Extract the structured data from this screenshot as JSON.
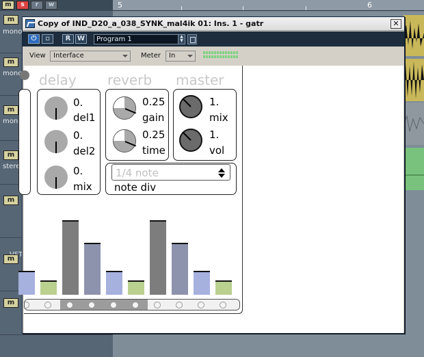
{
  "daw": {
    "ruler_numbers": [
      "5",
      "6"
    ],
    "top_buttons": [
      "m",
      "s",
      "r",
      "w"
    ],
    "tracks": [
      {
        "m": "m",
        "label": "mono"
      },
      {
        "m": "m",
        "label": "mono"
      },
      {
        "m": "m",
        "label": "mono"
      },
      {
        "m": "m",
        "label": "stereo"
      },
      {
        "m": "m",
        "label": ""
      },
      {
        "m": "m",
        "label": ""
      },
      {
        "m": "m",
        "label": ""
      }
    ],
    "vst_label": "VST"
  },
  "window": {
    "title": "Copy of IND_D20_a_038_SYNK_mal4ik 01: Ins. 1 - gatr",
    "close_label": "✕"
  },
  "toolbar": {
    "bypass_label": "⏻",
    "save_label": "▫",
    "read_label": "R",
    "write_label": "W",
    "program": "Program 1"
  },
  "view_bar": {
    "view_label": "View",
    "view_value": "Interface",
    "meter_label": "Meter",
    "meter_value": "In"
  },
  "sections": {
    "delay": {
      "title": "delay",
      "controls": [
        {
          "value": "0.",
          "label": "del1",
          "level": 0.5
        },
        {
          "value": "0.",
          "label": "del2",
          "level": 0.5
        },
        {
          "value": "0.",
          "label": "mix",
          "level": 0.5
        }
      ]
    },
    "reverb": {
      "title": "reverb",
      "controls": [
        {
          "value": "0.25",
          "label": "gain",
          "level": 0.25
        },
        {
          "value": "0.25",
          "label": "time",
          "level": 0.25
        }
      ],
      "note_div_value": "1/4 note",
      "note_div_label": "note div"
    },
    "master": {
      "title": "master",
      "controls": [
        {
          "value": "1.",
          "label": "mix",
          "level": 1.0
        },
        {
          "value": "1.",
          "label": "vol",
          "level": 1.0
        }
      ]
    }
  },
  "step_levels": [
    0.28,
    0.17,
    0.87,
    0.61,
    0.28,
    0.17,
    0.87,
    0.61,
    0.28,
    0.17
  ],
  "step_types": [
    "blue",
    "green",
    "gray",
    "slate",
    "blue",
    "green",
    "gray",
    "slate",
    "blue",
    "green"
  ],
  "colors": {
    "blue": "#a6b1de",
    "green": "#b9d08f",
    "gray": "#7d7d7d",
    "slate": "#8e93ad"
  }
}
